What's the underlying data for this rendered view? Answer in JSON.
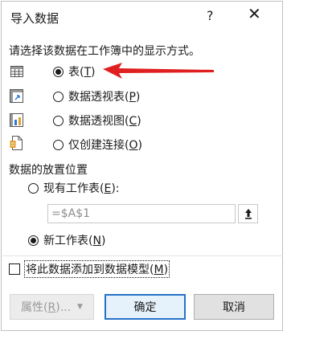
{
  "dialog": {
    "title": "导入数据",
    "help_glyph": "?",
    "close_glyph": "✕"
  },
  "display_prompt": "请选择该数据在工作簿中的显示方式。",
  "display_options": [
    {
      "text": "表",
      "hotkey": "T",
      "icon": "table-icon",
      "selected": true
    },
    {
      "text": "数据透视表",
      "hotkey": "P",
      "icon": "pivot-table-icon",
      "selected": false
    },
    {
      "text": "数据透视图",
      "hotkey": "C",
      "icon": "pivot-chart-icon",
      "selected": false
    },
    {
      "text": "仅创建连接",
      "hotkey": "O",
      "icon": "connection-only-icon",
      "selected": false
    }
  ],
  "placement_heading": "数据的放置位置",
  "placement_options": [
    {
      "text": "现有工作表",
      "hotkey": "E",
      "suffix": ":",
      "selected": false
    },
    {
      "text": "新工作表",
      "hotkey": "N",
      "suffix": "",
      "selected": true
    }
  ],
  "location_field_value": "=$A$1",
  "data_model_checkbox": {
    "text": "将此数据添加到数据模型",
    "hotkey": "M",
    "checked": false
  },
  "buttons": {
    "properties": {
      "text": "属性",
      "hotkey": "R",
      "suffix": "..."
    },
    "ok": "确定",
    "cancel": "取消"
  },
  "colors": {
    "annotation_arrow": "#e02020",
    "default_button_border": "#2672c9",
    "disabled_text": "#9a9a9a"
  }
}
